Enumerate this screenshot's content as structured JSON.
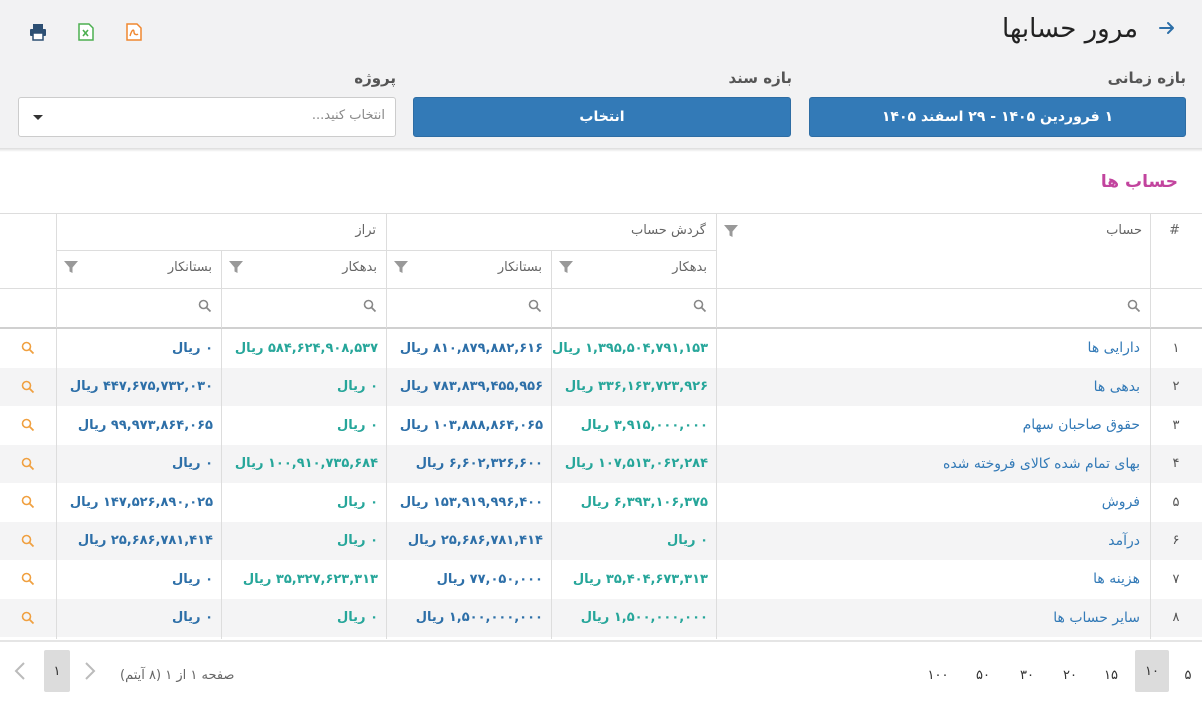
{
  "header": {
    "title": "مرور حسابها",
    "back_icon": "arrow-right-icon",
    "tools": [
      {
        "name": "print-icon",
        "color": "#2d4f73"
      },
      {
        "name": "excel-icon",
        "color": "#4caf50"
      },
      {
        "name": "pdf-icon",
        "color": "#f0872f"
      }
    ]
  },
  "filters": {
    "date_range_label": "بازه زمانی",
    "date_range_value": "۱ فروردین ۱۴۰۵ - ۲۹ اسفند ۱۴۰۵",
    "doc_range_label": "بازه سند",
    "doc_range_value": "انتخاب",
    "project_label": "پروژه",
    "project_placeholder": "انتخاب کنید..."
  },
  "section_title": "حساب ها",
  "table": {
    "headers": {
      "index": "#",
      "account": "حساب",
      "turnover_group": "گردش حساب",
      "balance_group": "تراز",
      "debit": "بدهکار",
      "credit": "بستانکار"
    },
    "rows": [
      {
        "num": "۱",
        "account": "دارایی ها",
        "t_debit": "۱,۳۹۵,۵۰۴,۷۹۱,۱۵۳ ریال",
        "t_credit": "۸۱۰,۸۷۹,۸۸۲,۶۱۶ ریال",
        "b_debit": "۵۸۴,۶۲۴,۹۰۸,۵۳۷ ریال",
        "b_credit": "۰ ریال"
      },
      {
        "num": "۲",
        "account": "بدهی ها",
        "t_debit": "۳۳۶,۱۶۳,۷۲۳,۹۲۶ ریال",
        "t_credit": "۷۸۳,۸۳۹,۴۵۵,۹۵۶ ریال",
        "b_debit": "۰ ریال",
        "b_credit": "۴۴۷,۶۷۵,۷۳۲,۰۳۰ ریال"
      },
      {
        "num": "۳",
        "account": "حقوق صاحبان سهام",
        "t_debit": "۳,۹۱۵,۰۰۰,۰۰۰ ریال",
        "t_credit": "۱۰۳,۸۸۸,۸۶۴,۰۶۵ ریال",
        "b_debit": "۰ ریال",
        "b_credit": "۹۹,۹۷۳,۸۶۴,۰۶۵ ریال"
      },
      {
        "num": "۴",
        "account": "بهای تمام شده کالای فروخته شده",
        "t_debit": "۱۰۷,۵۱۳,۰۶۲,۲۸۴ ریال",
        "t_credit": "۶,۶۰۲,۳۲۶,۶۰۰ ریال",
        "b_debit": "۱۰۰,۹۱۰,۷۳۵,۶۸۴ ریال",
        "b_credit": "۰ ریال"
      },
      {
        "num": "۵",
        "account": "فروش",
        "t_debit": "۶,۳۹۳,۱۰۶,۳۷۵ ریال",
        "t_credit": "۱۵۳,۹۱۹,۹۹۶,۴۰۰ ریال",
        "b_debit": "۰ ریال",
        "b_credit": "۱۴۷,۵۲۶,۸۹۰,۰۲۵ ریال"
      },
      {
        "num": "۶",
        "account": "درآمد",
        "t_debit": "۰ ریال",
        "t_credit": "۲۵,۶۸۶,۷۸۱,۴۱۴ ریال",
        "b_debit": "۰ ریال",
        "b_credit": "۲۵,۶۸۶,۷۸۱,۴۱۴ ریال"
      },
      {
        "num": "۷",
        "account": "هزینه ها",
        "t_debit": "۳۵,۴۰۴,۶۷۳,۳۱۳ ریال",
        "t_credit": "۷۷,۰۵۰,۰۰۰ ریال",
        "b_debit": "۳۵,۳۲۷,۶۲۳,۳۱۳ ریال",
        "b_credit": "۰ ریال"
      },
      {
        "num": "۸",
        "account": "سایر حساب ها",
        "t_debit": "۱,۵۰۰,۰۰۰,۰۰۰ ریال",
        "t_credit": "۱,۵۰۰,۰۰۰,۰۰۰ ریال",
        "b_debit": "۰ ریال",
        "b_credit": "۰ ریال"
      }
    ]
  },
  "pager": {
    "sizes": [
      "۵",
      "۱۰",
      "۱۵",
      "۲۰",
      "۳۰",
      "۵۰",
      "۱۰۰"
    ],
    "active_size": "۱۰",
    "info": "صفحه ۱ از ۱ (۸ آیتم)",
    "current_page": "۱"
  },
  "colors": {
    "accent": "#337ab7",
    "section_title": "#c2449e",
    "debit_green": "#26a69a",
    "credit_blue": "#2d6fa8",
    "view_icon": "#f0a040"
  }
}
